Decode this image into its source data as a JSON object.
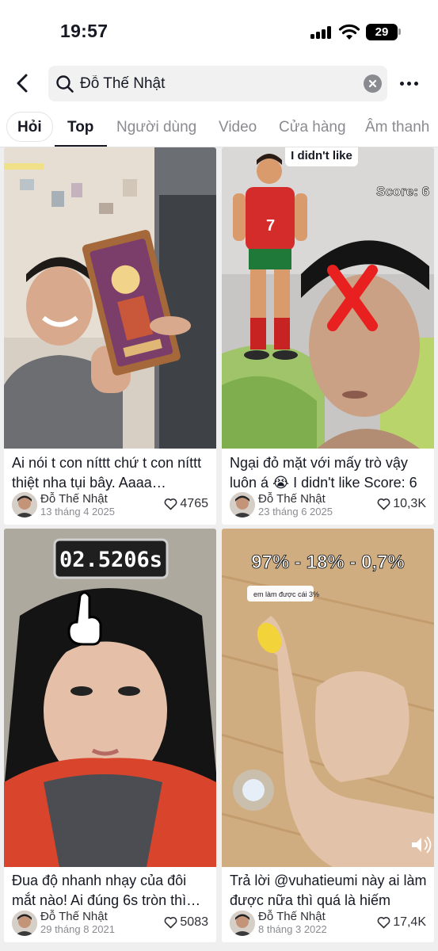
{
  "status_bar": {
    "time": "19:57",
    "battery": "29"
  },
  "search": {
    "query": "Đỗ Thế Nhật"
  },
  "tabs": [
    {
      "label": "Hỏi"
    },
    {
      "label": "Top"
    },
    {
      "label": "Người dùng"
    },
    {
      "label": "Video"
    },
    {
      "label": "Cửa hàng"
    },
    {
      "label": "Âm thanh"
    }
  ],
  "results": [
    {
      "caption": "Ai nói t con níttt chứ t con níttt thiệt nha tụi bây.  Aaaa…",
      "author": "Đỗ Thế Nhật",
      "date": "13 tháng 4 2025",
      "likes": "4765",
      "overlay": ""
    },
    {
      "caption": "Ngại đỏ mặt với mấy trò vậy luôn á 😭 I didn't like Score: 6",
      "author": "Đỗ Thế Nhật",
      "date": "23 tháng 6 2025",
      "likes": "10,3K",
      "overlay": "I didn't like",
      "overlay2": "Score: 6"
    },
    {
      "caption": "Đua độ nhanh nhạy của đôi mắt nào!  Ai đúng 6s tròn thì…",
      "author": "Đỗ Thế Nhật",
      "date": "29 tháng 8 2021",
      "likes": "5083",
      "overlay": "02.5206s"
    },
    {
      "caption": "Trả lời @vuhatieumi này ai làm được nữa thì quá là hiếm luô…",
      "author": "Đỗ Thế Nhật",
      "date": "8 tháng 3 2022",
      "likes": "17,4K",
      "overlay": "97% - 18% - 0,7%",
      "overlay2": "em làm được cái 3%"
    }
  ]
}
